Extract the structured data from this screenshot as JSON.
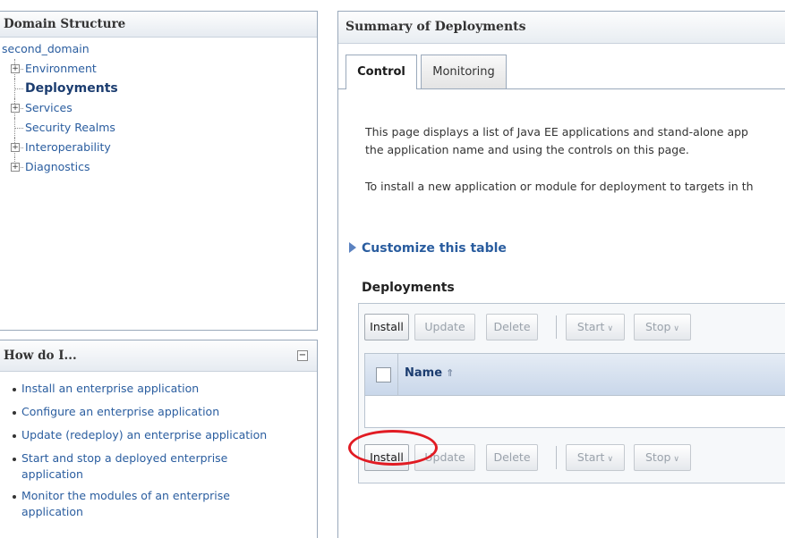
{
  "domain_panel": {
    "title": "Domain Structure",
    "root": "second_domain",
    "items": [
      {
        "label": "Environment",
        "expandable": true,
        "bold": false
      },
      {
        "label": "Deployments",
        "expandable": false,
        "bold": true
      },
      {
        "label": "Services",
        "expandable": true,
        "bold": false
      },
      {
        "label": "Security Realms",
        "expandable": false,
        "bold": false
      },
      {
        "label": "Interoperability",
        "expandable": true,
        "bold": false
      },
      {
        "label": "Diagnostics",
        "expandable": true,
        "bold": false
      }
    ]
  },
  "how_panel": {
    "title": "How do I...",
    "items": [
      "Install an enterprise application",
      "Configure an enterprise application",
      "Update (redeploy) an enterprise application",
      "Start and stop a deployed enterprise application",
      "Monitor the modules of an enterprise application"
    ]
  },
  "summary": {
    "title": "Summary of Deployments",
    "tabs": [
      "Control",
      "Monitoring"
    ],
    "para1_line1": "This page displays a list of Java EE applications and stand-alone app",
    "para1_line2": "the application name and using the controls on this page.",
    "para2": "To install a new application or module for deployment to targets in th",
    "customize_link": "Customize this table",
    "deployments_title": "Deployments",
    "buttons": {
      "install": "Install",
      "update": "Update",
      "delete": "Delete",
      "start": "Start",
      "stop": "Stop"
    },
    "column_name": "Name"
  },
  "colors": {
    "link": "#2a5d9f",
    "highlight": "#e11b23",
    "table_header": "#c9d7ea"
  }
}
